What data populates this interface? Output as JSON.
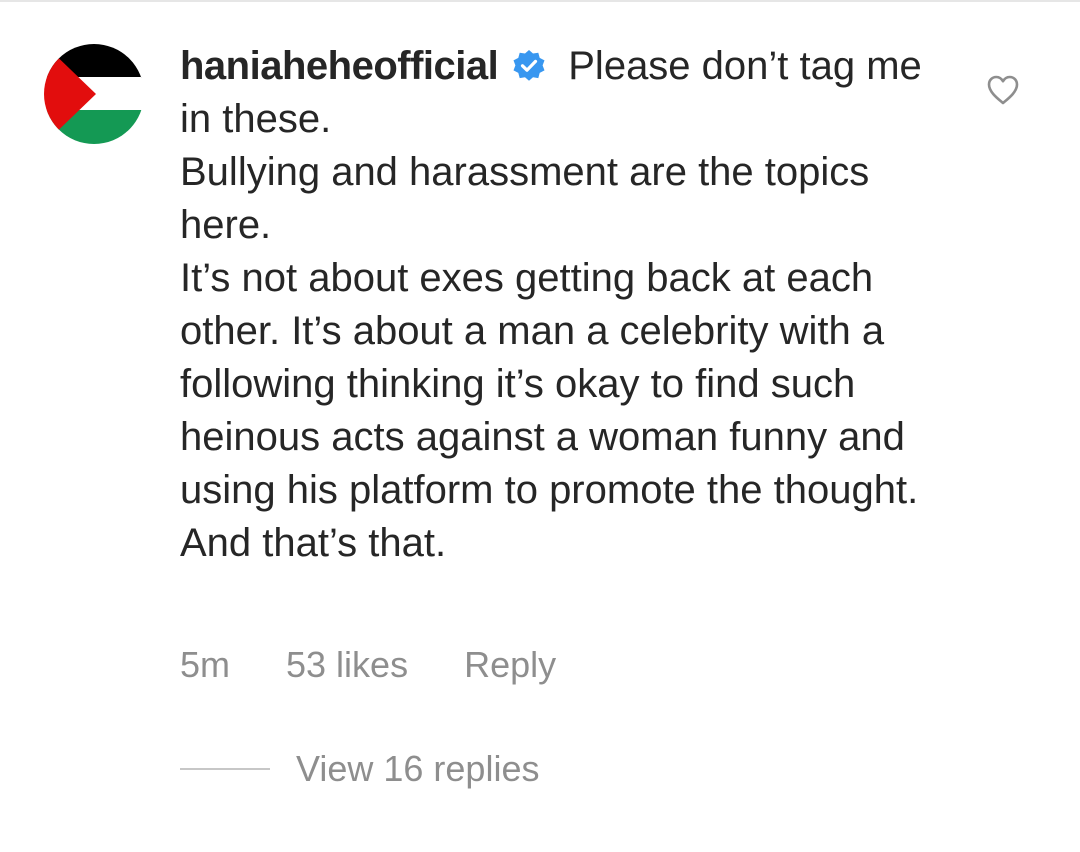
{
  "comment": {
    "username": "haniaheheofficial",
    "verified": true,
    "text": "Please don’t tag me in these.\nBullying and harassment are the topics here.\nIt’s not about exes getting back at each other. It’s about a man a celebrity with a following thinking it’s okay to find such heinous acts against a woman funny and using his platform to promote the thought. And that’s that.",
    "time": "5m",
    "likes": "53 likes",
    "reply_label": "Reply",
    "view_replies_label": "View 16 replies"
  },
  "colors": {
    "text": "#262626",
    "meta": "#8e8e8e",
    "verified_blue": "#3897f0",
    "flag_black": "#000000",
    "flag_white": "#ffffff",
    "flag_green": "#149954",
    "flag_red": "#e20d0d"
  },
  "icons": {
    "avatar": "palestine-flag-avatar",
    "verified": "verified-badge-icon",
    "like": "heart-outline-icon"
  }
}
